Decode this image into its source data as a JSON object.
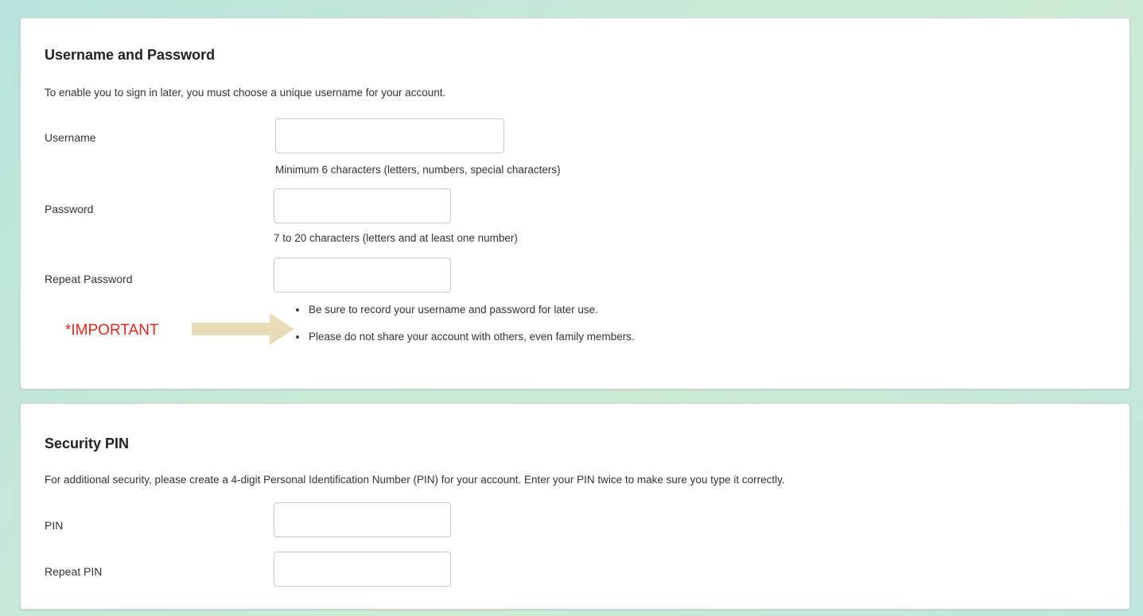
{
  "account_section": {
    "title": "Username and Password",
    "intro": "To enable you to sign in later, you must choose a unique username for your account.",
    "username": {
      "label": "Username",
      "value": "",
      "hint": "Minimum 6 characters (letters, numbers, special characters)"
    },
    "password": {
      "label": "Password",
      "value": "",
      "hint": "7 to 20 characters (letters and at least one number)"
    },
    "repeat_password": {
      "label": "Repeat Password",
      "value": ""
    },
    "tips": [
      "Be sure to record your username and password for later use.",
      "Please do not share your account with others, even family members."
    ]
  },
  "annotation": {
    "text": "*IMPORTANT",
    "text_color": "#e0281e",
    "arrow_color": "#e8dcb8"
  },
  "pin_section": {
    "title": "Security PIN",
    "intro": "For additional security, please create a 4-digit Personal Identification Number (PIN) for your account. Enter your PIN twice to make sure you type it correctly.",
    "pin": {
      "label": "PIN",
      "value": ""
    },
    "repeat_pin": {
      "label": "Repeat PIN",
      "value": ""
    }
  }
}
